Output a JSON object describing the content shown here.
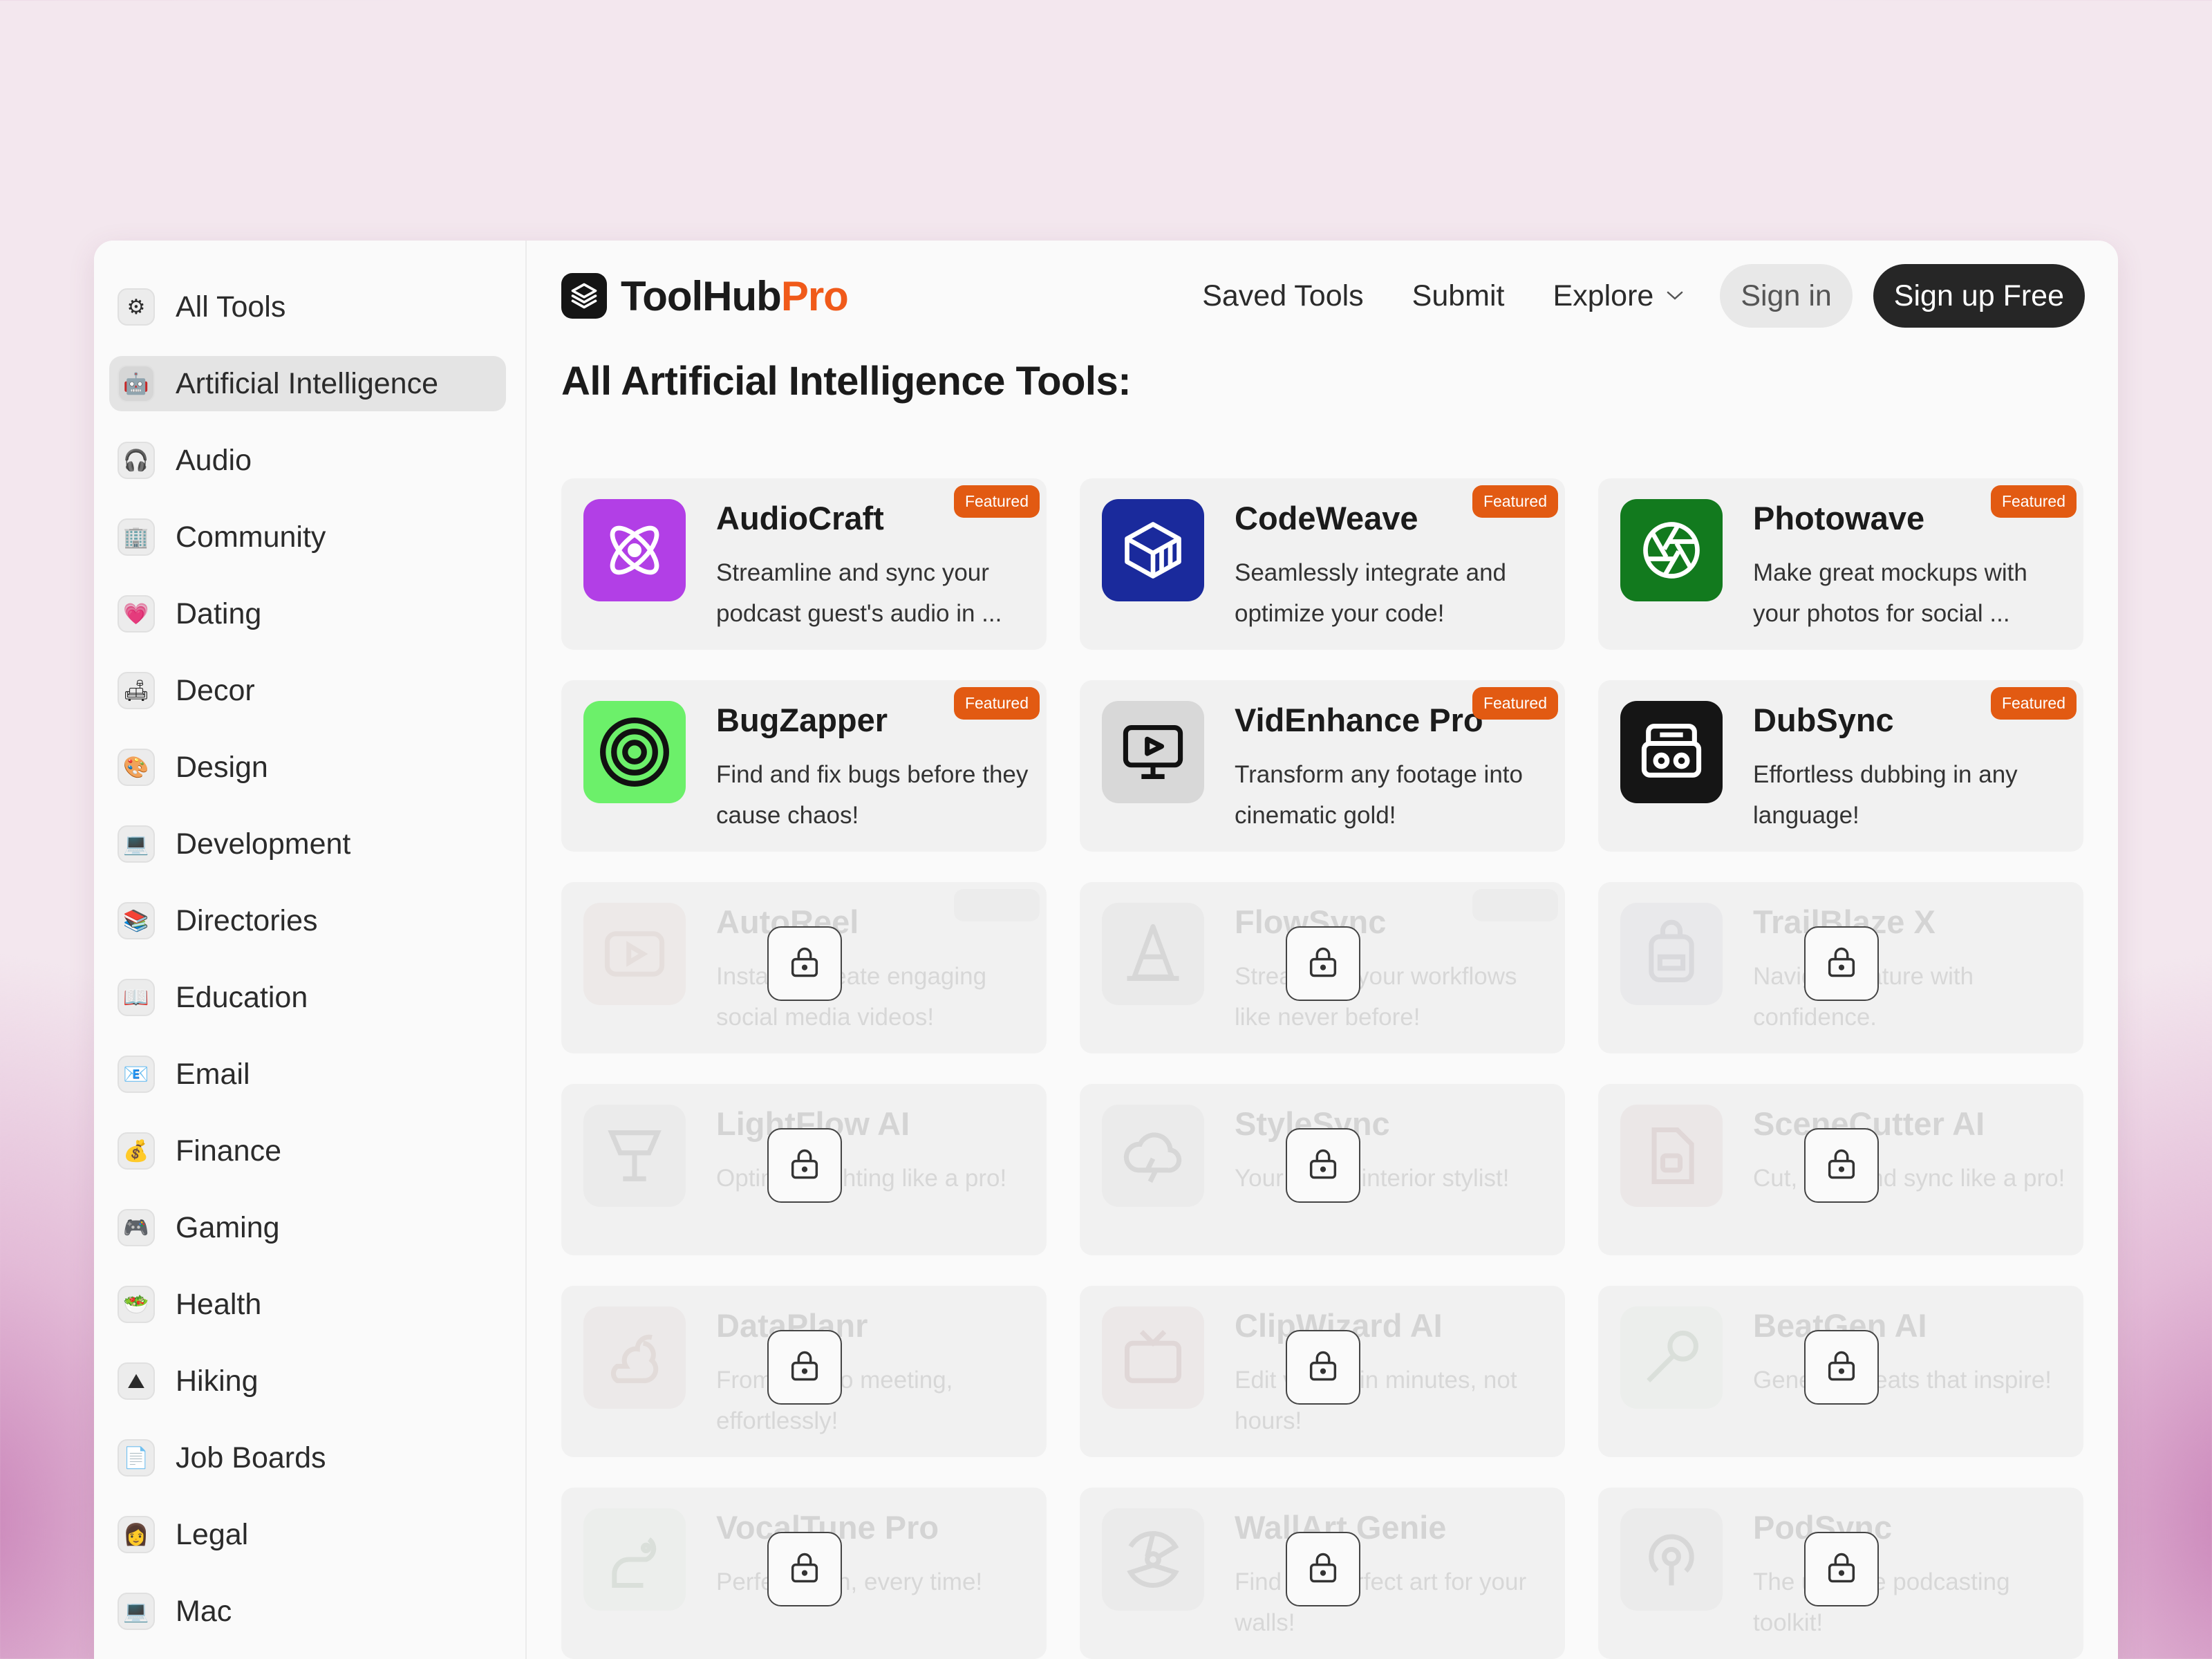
{
  "sidebar": {
    "items": [
      {
        "label": "All Tools",
        "emoji": "⚙"
      },
      {
        "label": "Artificial Intelligence",
        "emoji": "🤖",
        "active": true
      },
      {
        "label": "Audio",
        "emoji": "🎧"
      },
      {
        "label": "Community",
        "emoji": "🏢"
      },
      {
        "label": "Dating",
        "emoji": "💗"
      },
      {
        "label": "Decor",
        "emoji": "🛋"
      },
      {
        "label": "Design",
        "emoji": "🎨"
      },
      {
        "label": "Development",
        "emoji": "💻"
      },
      {
        "label": "Directories",
        "emoji": "📚"
      },
      {
        "label": "Education",
        "emoji": "📖"
      },
      {
        "label": "Email",
        "emoji": "📧"
      },
      {
        "label": "Finance",
        "emoji": "💰"
      },
      {
        "label": "Gaming",
        "emoji": "🎮"
      },
      {
        "label": "Health",
        "emoji": "🥗"
      },
      {
        "label": "Hiking",
        "emoji": "⛰"
      },
      {
        "label": "Job Boards",
        "emoji": "📄"
      },
      {
        "label": "Legal",
        "emoji": "👩"
      },
      {
        "label": "Mac",
        "emoji": "💻"
      }
    ]
  },
  "header": {
    "logo_main": "ToolHub",
    "logo_accent": "Pro",
    "nav_saved": "Saved Tools",
    "nav_submit": "Submit",
    "nav_explore": "Explore",
    "signin": "Sign in",
    "signup": "Sign up Free"
  },
  "page": {
    "title": "All Artificial Intelligence Tools:"
  },
  "colors": {
    "accent": "#f05a1a",
    "badge": "#e25a12"
  },
  "featured_label": "Featured",
  "tools": [
    {
      "name": "AudioCraft",
      "desc": "Streamline and sync your podcast guest's audio in ...",
      "featured": true,
      "icon": "atom-icon",
      "icon_bg": "#b23fe6",
      "locked": false
    },
    {
      "name": "CodeWeave",
      "desc": "Seamlessly integrate and optimize your code!",
      "featured": true,
      "icon": "cube-icon",
      "icon_bg": "#1a2a9c",
      "locked": false
    },
    {
      "name": "Photowave",
      "desc": "Make great mockups with your photos for social ...",
      "featured": true,
      "icon": "aperture-icon",
      "icon_bg": "#127a1e",
      "locked": false
    },
    {
      "name": "BugZapper",
      "desc": "Find and fix bugs before they cause chaos!",
      "featured": true,
      "icon": "target-icon",
      "icon_bg": "#6cf06a",
      "locked": false
    },
    {
      "name": "VidEnhance Pro",
      "desc": "Transform any footage into cinematic gold!",
      "featured": true,
      "icon": "monitor-play-icon",
      "icon_bg": "#d8d8d8",
      "locked": false
    },
    {
      "name": "DubSync",
      "desc": "Effortless dubbing in any language!",
      "featured": true,
      "icon": "boombox-icon",
      "icon_bg": "#151515",
      "locked": false
    },
    {
      "name": "AutoReel",
      "desc": "Instantly create engaging social media videos!",
      "featured": true,
      "icon": "play-icon",
      "icon_bg": "#f2b49a",
      "locked": true
    },
    {
      "name": "FlowSync",
      "desc": "Streamline your workflows like never before!",
      "featured": true,
      "icon": "cone-icon",
      "icon_bg": "#bdbdbd",
      "locked": true
    },
    {
      "name": "TrailBlaze X",
      "desc": "Navigate nature with confidence.",
      "featured": false,
      "icon": "backpack-icon",
      "icon_bg": "#b4b8d8",
      "locked": true
    },
    {
      "name": "LightFlow AI",
      "desc": "Optimize lighting like a pro!",
      "featured": false,
      "icon": "lamp-icon",
      "icon_bg": "#c8c8c8",
      "locked": true
    },
    {
      "name": "StyleSync",
      "desc": "Your virtual interior stylist!",
      "featured": false,
      "icon": "cloud-icon",
      "icon_bg": "#c8c8c8",
      "locked": true
    },
    {
      "name": "SceneCutter AI",
      "desc": "Cut, edit, and sync like a pro!",
      "featured": false,
      "icon": "film-icon",
      "icon_bg": "#f2a0a0",
      "locked": true
    },
    {
      "name": "DataPlanr",
      "desc": "From data to meeting, effortlessly!",
      "featured": false,
      "icon": "squirrel-icon",
      "icon_bg": "#f2b0a8",
      "locked": true
    },
    {
      "name": "ClipWizard AI",
      "desc": "Edit videos in minutes, not hours!",
      "featured": false,
      "icon": "tv-icon",
      "icon_bg": "#f0a8a0",
      "locked": true
    },
    {
      "name": "BeatGen AI",
      "desc": "Generate beats that inspire!",
      "featured": false,
      "icon": "mic-icon",
      "icon_bg": "#b8e8b8",
      "locked": true
    },
    {
      "name": "VocalTune Pro",
      "desc": "Perfect pitch, every time!",
      "featured": false,
      "icon": "rat-icon",
      "icon_bg": "#c0e0c0",
      "locked": true
    },
    {
      "name": "WallArt Genie",
      "desc": "Find the perfect art for your walls!",
      "featured": false,
      "icon": "radiation-icon",
      "icon_bg": "#c8c8c8",
      "locked": true
    },
    {
      "name": "PodSync",
      "desc": "The ultimate podcasting toolkit!",
      "featured": false,
      "icon": "podcast-icon",
      "icon_bg": "#c8c8c8",
      "locked": true
    }
  ]
}
